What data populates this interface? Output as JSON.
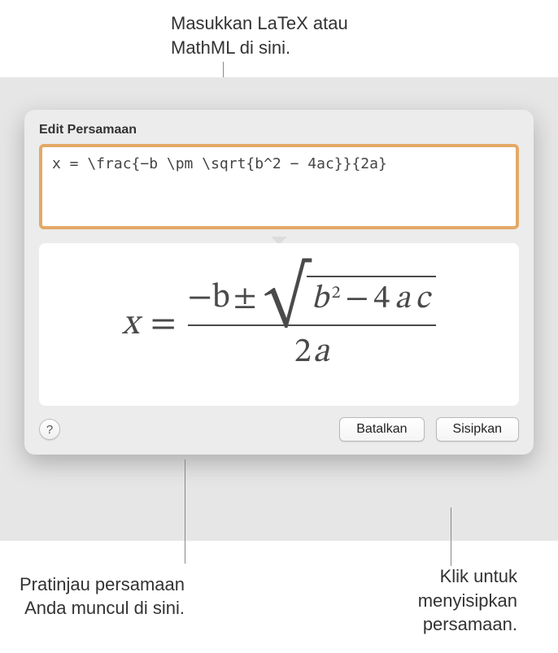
{
  "callouts": {
    "top": "Masukkan LaTeX atau\nMathML di sini.",
    "bottom_left": "Pratinjau persamaan\nAnda muncul di sini.",
    "bottom_right": "Klik untuk\nmenyisipkan\npersamaan."
  },
  "dialog": {
    "title": "Edit Persamaan",
    "editor_value": "x = \\frac{−b \\pm \\sqrt{b^2 − 4ac}}{2a}",
    "help_label": "?",
    "cancel_label": "Batalkan",
    "insert_label": "Sisipkan"
  },
  "equation_preview": {
    "lhs": "x",
    "equals": "=",
    "numerator_prefix": "−b",
    "plus_minus": "±",
    "radicand_b": "b",
    "radicand_exp": "2",
    "radicand_minus": "−",
    "radicand_four": "4",
    "radicand_a": "a",
    "radicand_c": "c",
    "denominator_two": "2",
    "denominator_a": "a"
  }
}
